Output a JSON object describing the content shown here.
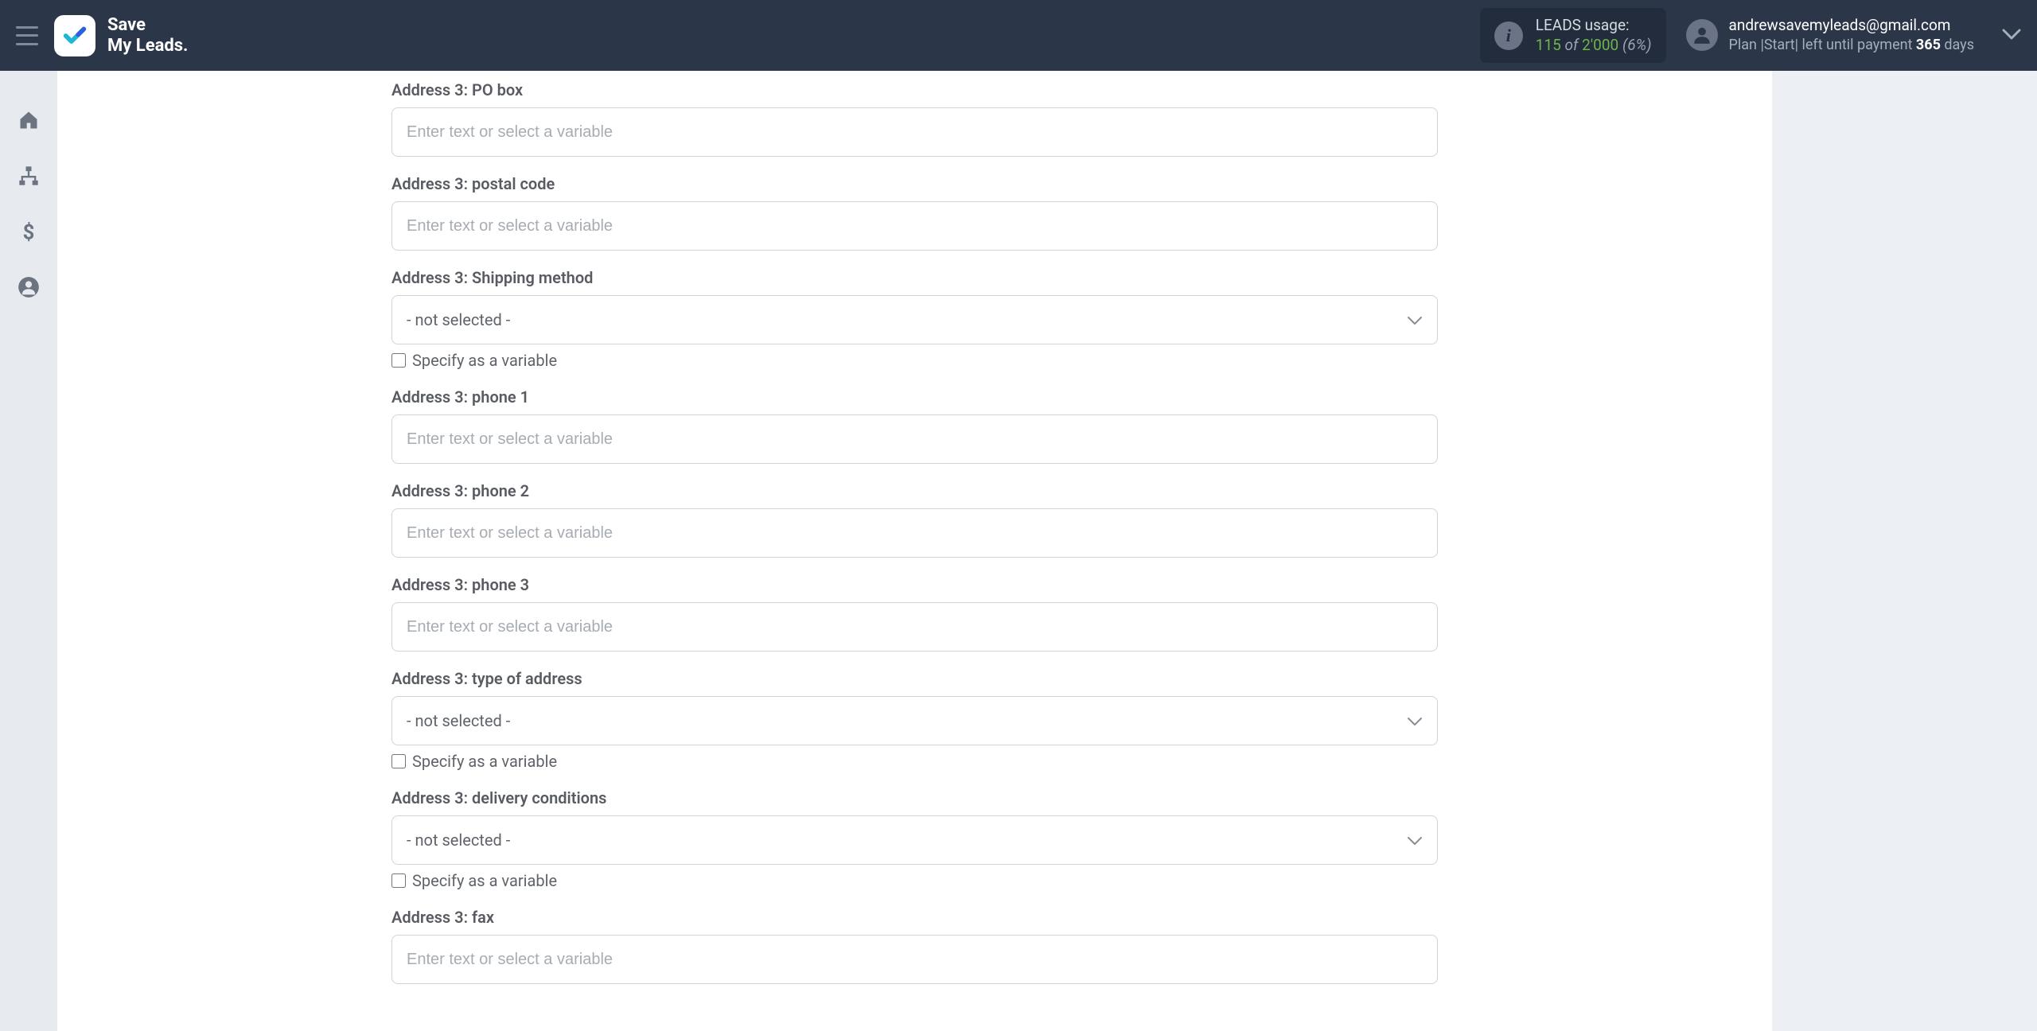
{
  "brand": {
    "line1": "Save",
    "line2": "My Leads."
  },
  "usage": {
    "label": "LEADS usage:",
    "used": "115",
    "of": "of",
    "total": "2'000",
    "pct": "(6%)"
  },
  "account": {
    "email": "andrewsavemyleads@gmail.com",
    "plan_prefix": "Plan |Start| left until payment ",
    "days": "365",
    "days_suffix": " days"
  },
  "form": {
    "placeholder_text": "Enter text or select a variable",
    "select_default": "- not selected -",
    "specify_variable": "Specify as a variable",
    "fields": {
      "po_box": {
        "label": "Address 3: PO box"
      },
      "postal_code": {
        "label": "Address 3: postal code"
      },
      "shipping_method": {
        "label": "Address 3: Shipping method"
      },
      "phone1": {
        "label": "Address 3: phone 1"
      },
      "phone2": {
        "label": "Address 3: phone 2"
      },
      "phone3": {
        "label": "Address 3: phone 3"
      },
      "type_of_address": {
        "label": "Address 3: type of address"
      },
      "delivery_conditions": {
        "label": "Address 3: delivery conditions"
      },
      "fax": {
        "label": "Address 3: fax"
      }
    }
  }
}
